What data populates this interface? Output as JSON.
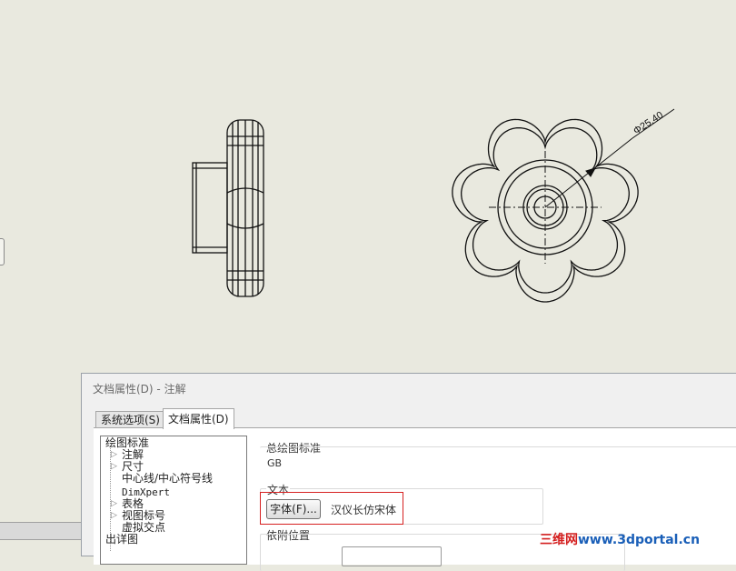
{
  "drawing": {
    "dimension_label": "Φ25.40"
  },
  "dialog": {
    "title": "文档属性(D) - 注解",
    "tabs": [
      {
        "label": "系统选项(S)",
        "active": false
      },
      {
        "label": "文档属性(D)",
        "active": true
      }
    ],
    "tree": [
      {
        "label": "绘图标准",
        "expandable": false
      },
      {
        "label": "注解",
        "expandable": true
      },
      {
        "label": "尺寸",
        "expandable": true
      },
      {
        "label": "中心线/中心符号线",
        "expandable": false
      },
      {
        "label": "DimXpert",
        "expandable": false
      },
      {
        "label": "表格",
        "expandable": true
      },
      {
        "label": "视图标号",
        "expandable": true
      },
      {
        "label": "虚拟交点",
        "expandable": false
      },
      {
        "label": "出详图",
        "expandable": false
      }
    ],
    "overall_standard": {
      "label": "总绘图标准",
      "value": "GB"
    },
    "text_group": {
      "label": "文本",
      "font_button": "字体(F)...",
      "font_name": "汉仪长仿宋体"
    },
    "attachment_group": {
      "label": "依附位置"
    }
  },
  "watermark": {
    "part1": "三维网",
    "part2": "www.3dportal.cn"
  },
  "colors": {
    "canvas_background": "#e9e9df",
    "line": "#111111",
    "highlight": "#d62020"
  }
}
